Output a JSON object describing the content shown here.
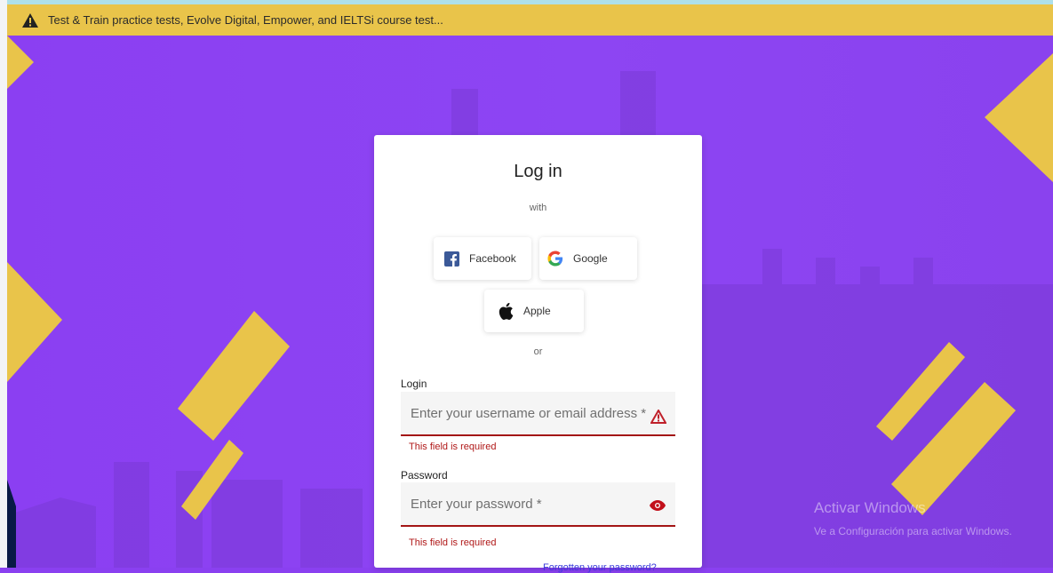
{
  "banner": {
    "text": "Test & Train practice tests, Evolve Digital, Empower, and IELTSi course test...",
    "icon": "warning-triangle-icon"
  },
  "login": {
    "title": "Log in",
    "with": "with",
    "facebook_label": "Facebook",
    "google_label": "Google",
    "apple_label": "Apple",
    "or": "or",
    "login_label": "Login",
    "login_placeholder": "Enter your username or email address *",
    "login_error": "This field is required",
    "password_label": "Password",
    "password_placeholder": "Enter your password *",
    "password_error": "This field is required",
    "forgot": "Forgotten your password?"
  },
  "watermark": {
    "line1": "Activar Windows",
    "line2": "Ve a Configuración para activar Windows."
  },
  "colors": {
    "background": "#8a40f0",
    "accent_yellow": "#e9c44a",
    "error": "#b01818",
    "facebook": "#3b5998"
  }
}
